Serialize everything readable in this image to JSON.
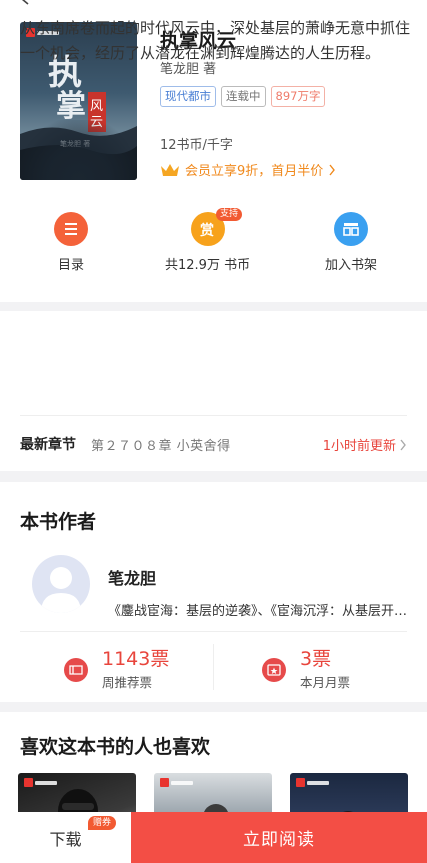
{
  "book": {
    "title": "执掌风云",
    "author_line": "笔龙胆 著",
    "cover_title": "执掌风云",
    "tags": [
      "现代都市",
      "连载中",
      "897万字"
    ],
    "price": "12书币/千字",
    "vip_offer": "会员立享9折，首月半价"
  },
  "actions": {
    "catalog_label": "目录",
    "reward_badge": "支持",
    "reward_label": "共12.9万 书币",
    "shelf_label": "加入书架"
  },
  "description": {
    "text": "从东南席卷而起的时代风云中，深处基层的萧峥无意中抓住一个机会，经历了从潜龙在渊到辉煌腾达的人生历程。",
    "latest_label": "最新章节",
    "latest_chapter": "第２７０８章 小英舍得",
    "updated": "1小时前更新"
  },
  "author_section": {
    "title": "本书作者",
    "name": "笔龙胆",
    "works": "《鏖战宦海：基层的逆袭》、《宦海沉浮：从基层开始》",
    "weekly_votes": "1143票",
    "weekly_label": "周推荐票",
    "monthly_votes": "3票",
    "monthly_label": "本月月票"
  },
  "recommend": {
    "title": "喜欢这本书的人也喜欢"
  },
  "bottom": {
    "download": "下载",
    "coupon": "赠券",
    "read": "立即阅读"
  },
  "colors": {
    "accent": "#f34e45",
    "vip": "#f0891c",
    "tag_blue": "#4a7fd4"
  }
}
